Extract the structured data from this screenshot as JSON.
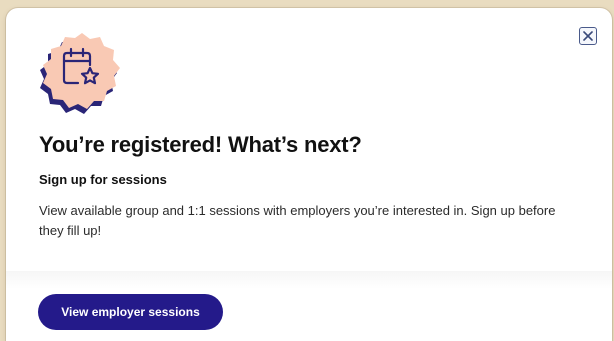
{
  "dialog": {
    "title": "You’re registered! What’s next?",
    "subtitle": "Sign up for sessions",
    "body": "View available group and 1:1 sessions with employers you’re interested in. Sign up before they fill up!",
    "primary_button_label": "View employer sessions",
    "badge_icon": "calendar-star-icon",
    "close_icon": "close-icon"
  },
  "colors": {
    "page_background": "#e9dcc0",
    "badge_fill": "#f9c9b4",
    "badge_shadow": "#2a2577",
    "primary_button": "#241a8a",
    "close_border": "#4a5a8a"
  }
}
